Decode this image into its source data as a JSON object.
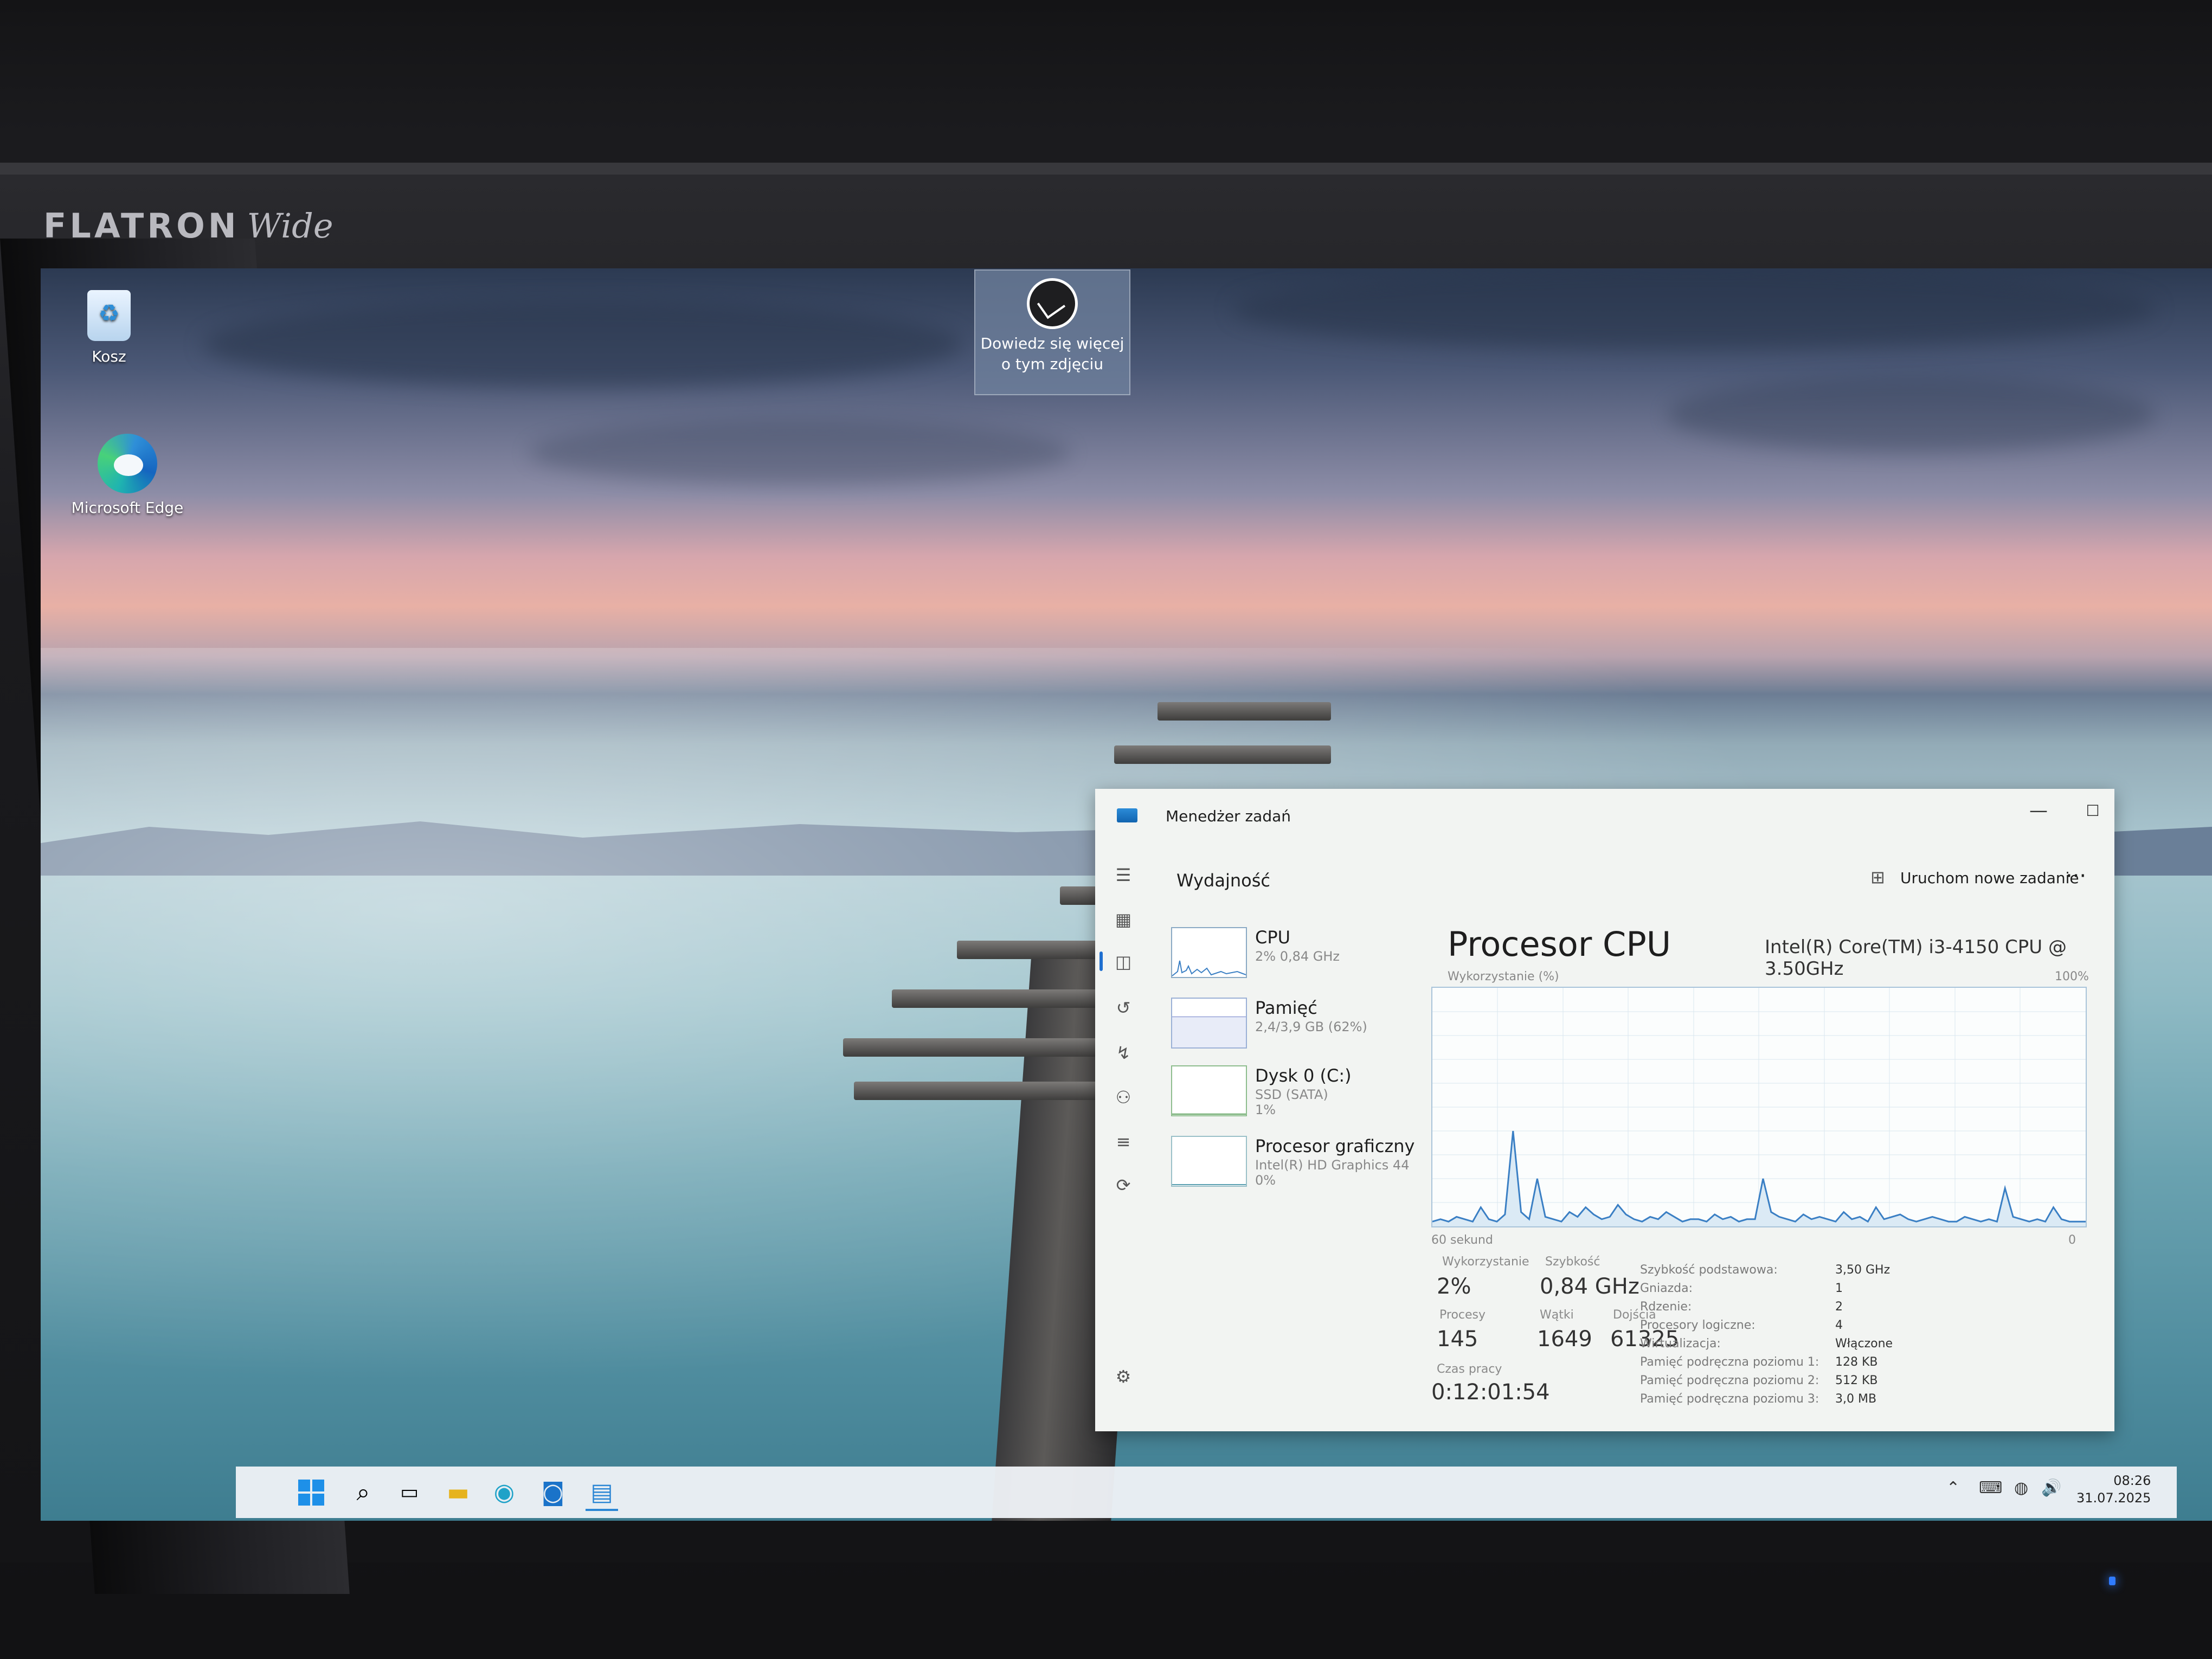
{
  "monitor": {
    "brand": "FLATRON",
    "model": "Wide"
  },
  "desktop": {
    "icons": [
      {
        "label": "Kosz",
        "icon": "recycle-bin-icon"
      },
      {
        "label": "Microsoft Edge",
        "icon": "edge-icon"
      }
    ],
    "spotlight": {
      "label": "Dowiedz się więcej o tym zdjęciu",
      "icon": "spotlight-camera-icon"
    }
  },
  "task_manager": {
    "title": "Menedżer zadań",
    "page_title": "Wydajność",
    "new_task_label": "Uruchom nowe zadanie",
    "more_label": "···",
    "window_controls": {
      "minimize": "—",
      "maximize": "☐",
      "close": "✕"
    },
    "sidebar": [
      {
        "name": "CPU",
        "sub": "2% 0,84 GHz",
        "sub2": ""
      },
      {
        "name": "Pamięć",
        "sub": "2,4/3,9 GB (62%)",
        "sub2": ""
      },
      {
        "name": "Dysk 0 (C:)",
        "sub": "SSD (SATA)",
        "sub2": "1%"
      },
      {
        "name": "Procesor graficzny",
        "sub": "Intel(R) HD Graphics 44",
        "sub2": "0%"
      }
    ],
    "detail": {
      "title": "Procesor CPU",
      "model": "Intel(R) Core(TM) i3-4150 CPU @ 3.50GHz",
      "util_label": "Wykorzystanie (%)",
      "max_label": "100%",
      "time_label": "60 sekund",
      "min_label": "0",
      "stats": {
        "utilization_label": "Wykorzystanie",
        "utilization": "2%",
        "speed_label": "Szybkość",
        "speed": "0,84 GHz",
        "processes_label": "Procesy",
        "processes": "145",
        "threads_label": "Wątki",
        "threads": "1649",
        "handles_label": "Dojścia",
        "handles": "61325",
        "uptime_label": "Czas pracy",
        "uptime": "0:12:01:54"
      },
      "specs": [
        {
          "k": "Szybkość podstawowa:",
          "v": "3,50 GHz"
        },
        {
          "k": "Gniazda:",
          "v": "1"
        },
        {
          "k": "Rdzenie:",
          "v": "2"
        },
        {
          "k": "Procesory logiczne:",
          "v": "4"
        },
        {
          "k": "Wirtualizacja:",
          "v": "Włączone"
        },
        {
          "k": "Pamięć podręczna poziomu 1:",
          "v": "128 KB"
        },
        {
          "k": "Pamięć podręczna poziomu 2:",
          "v": "512 KB"
        },
        {
          "k": "Pamięć podręczna poziomu 3:",
          "v": "3,0 MB"
        }
      ]
    },
    "cpu_history_pct": [
      2,
      3,
      2,
      4,
      3,
      2,
      8,
      3,
      2,
      5,
      40,
      6,
      3,
      20,
      4,
      3,
      2,
      6,
      4,
      8,
      5,
      3,
      4,
      9,
      5,
      3,
      2,
      4,
      3,
      6,
      4,
      2,
      3,
      3,
      2,
      5,
      3,
      4,
      2,
      3,
      3,
      20,
      6,
      4,
      3,
      2,
      5,
      3,
      4,
      3,
      2,
      6,
      3,
      4,
      2,
      8,
      3,
      4,
      5,
      3,
      2,
      3,
      4,
      3,
      2,
      2,
      4,
      3,
      2,
      3,
      2,
      16,
      4,
      3,
      2,
      3,
      2,
      8,
      3,
      2,
      2,
      2
    ]
  },
  "taskbar": {
    "apps": [
      "windows-start-icon",
      "search-icon",
      "task-view-icon",
      "file-explorer-icon",
      "edge-icon",
      "outlook-icon",
      "task-manager-icon"
    ],
    "tray": [
      "chevron-up-icon",
      "keyboard-icon",
      "network-icon",
      "volume-icon"
    ],
    "time": "08:26",
    "date": "31.07.2025"
  }
}
